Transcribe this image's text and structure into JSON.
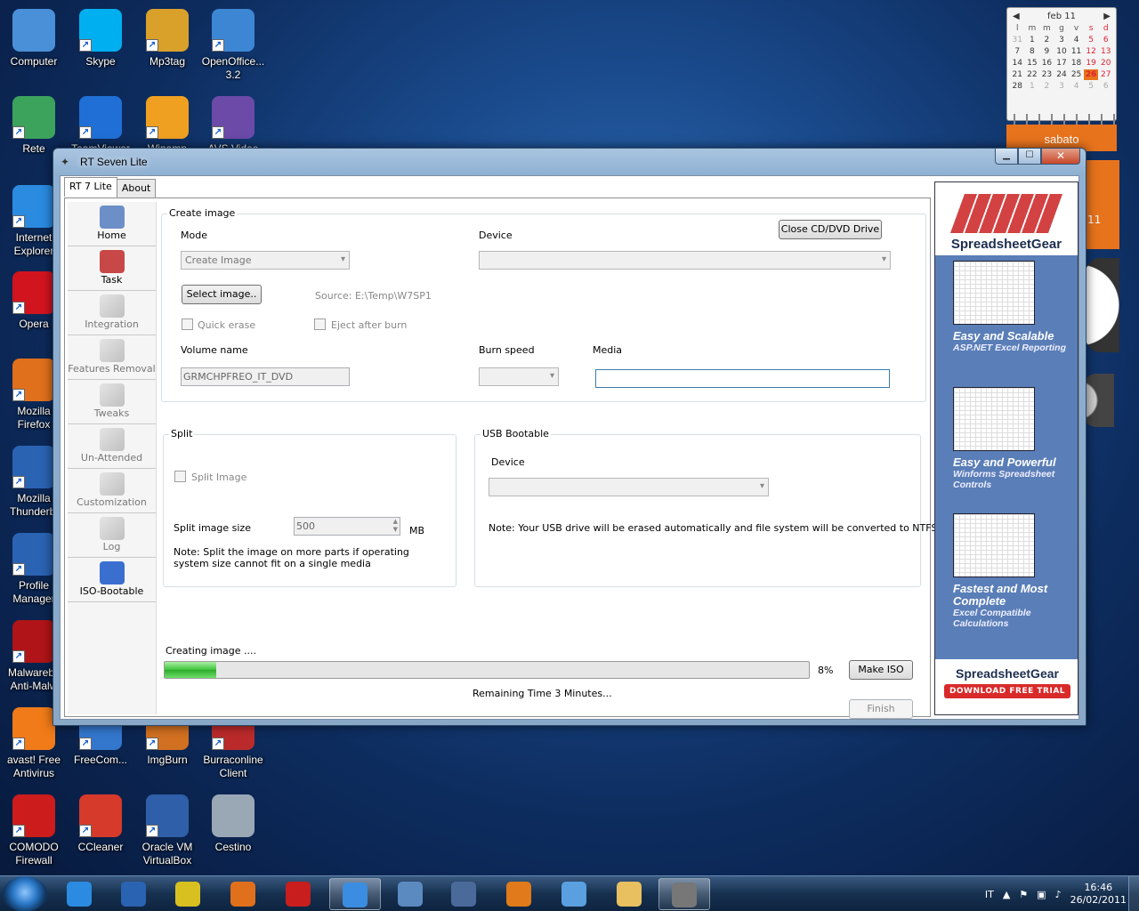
{
  "desktop": {
    "icons": [
      {
        "label": "Computer",
        "icon": "computer-icon",
        "color": "#4a90d9"
      },
      {
        "label": "Skype",
        "icon": "skype-icon",
        "color": "#00aff0"
      },
      {
        "label": "Mp3tag",
        "icon": "mp3tag-icon",
        "color": "#d9a12a"
      },
      {
        "label": "OpenOffice... 3.2",
        "icon": "openoffice-icon",
        "color": "#3d86d4"
      },
      {
        "label": "Rete",
        "icon": "network-icon",
        "color": "#3ca35c"
      },
      {
        "label": "TeamViewer",
        "icon": "teamviewer-icon",
        "color": "#1f6fd6"
      },
      {
        "label": "Winamp",
        "icon": "winamp-icon",
        "color": "#f0a020"
      },
      {
        "label": "AVS Video",
        "icon": "avs-video-icon",
        "color": "#6b4aa8"
      },
      {
        "label": "Internet Explorer",
        "icon": "internet-explorer-icon",
        "color": "#2a8be0"
      },
      {
        "label": "Opera",
        "icon": "opera-icon",
        "color": "#d2141f"
      },
      {
        "label": "Mozilla Firefox",
        "icon": "firefox-icon",
        "color": "#e0701c"
      },
      {
        "label": "Mozilla Thunderbi",
        "icon": "thunderbird-icon",
        "color": "#2b63b3"
      },
      {
        "label": "Profile Manager",
        "icon": "profile-manager-icon",
        "color": "#2b63b3"
      },
      {
        "label": "Malwareby Anti-Malw",
        "icon": "malwarebytes-icon",
        "color": "#b01418"
      },
      {
        "label": "avast! Free Antivirus",
        "icon": "avast-icon",
        "color": "#f07b18"
      },
      {
        "label": "FreeCom...",
        "icon": "freecommander-icon",
        "color": "#3377cc"
      },
      {
        "label": "ImgBurn",
        "icon": "imgburn-icon",
        "color": "#d07020"
      },
      {
        "label": "Burraconline Client",
        "icon": "burraconline-icon",
        "color": "#bb2a2a"
      },
      {
        "label": "COMODO Firewall",
        "icon": "comodo-icon",
        "color": "#cc1c1c"
      },
      {
        "label": "CCleaner",
        "icon": "ccleaner-icon",
        "color": "#d63a2a"
      },
      {
        "label": "Oracle VM VirtualBox",
        "icon": "virtualbox-icon",
        "color": "#2f5fa8"
      },
      {
        "label": "Cestino",
        "icon": "recycle-bin-icon",
        "color": "#9aa7b5"
      }
    ]
  },
  "calendar": {
    "month": "feb 11",
    "headers": [
      "l",
      "m",
      "m",
      "g",
      "v",
      "s",
      "d"
    ],
    "weeks": [
      [
        "31",
        "1",
        "2",
        "3",
        "4",
        "5",
        "6"
      ],
      [
        "7",
        "8",
        "9",
        "10",
        "11",
        "12",
        "13"
      ],
      [
        "14",
        "15",
        "16",
        "17",
        "18",
        "19",
        "20"
      ],
      [
        "21",
        "22",
        "23",
        "24",
        "25",
        "26",
        "27"
      ],
      [
        "28",
        "1",
        "2",
        "3",
        "4",
        "5",
        "6"
      ]
    ],
    "today": "26",
    "weekday": "sabato",
    "side_number": "11"
  },
  "window": {
    "title": "RT Seven Lite",
    "tabs": [
      "RT 7 Lite",
      "About"
    ],
    "nav": [
      {
        "label": "Home",
        "icon": "home-icon",
        "enabled": true
      },
      {
        "label": "Task",
        "icon": "task-icon",
        "enabled": true
      },
      {
        "label": "Integration",
        "icon": "integration-icon",
        "enabled": false
      },
      {
        "label": "Features Removal",
        "icon": "features-removal-icon",
        "enabled": false
      },
      {
        "label": "Tweaks",
        "icon": "tweaks-icon",
        "enabled": false
      },
      {
        "label": "Un-Attended",
        "icon": "unattended-icon",
        "enabled": false
      },
      {
        "label": "Customization",
        "icon": "customization-icon",
        "enabled": false
      },
      {
        "label": "Log",
        "icon": "log-icon",
        "enabled": false
      },
      {
        "label": "ISO-Bootable",
        "icon": "iso-bootable-icon",
        "enabled": true
      }
    ],
    "create_image": {
      "legend": "Create image",
      "mode_label": "Mode",
      "mode_value": "Create Image",
      "device_label": "Device",
      "device_value": "",
      "close_drive_button": "Close CD/DVD Drive",
      "select_image_button": "Select image..",
      "source_text": "Source: E:\\Temp\\W7SP1",
      "quick_erase_label": "Quick erase",
      "eject_label": "Eject after burn",
      "volume_label": "Volume name",
      "volume_value": "GRMCHPFREO_IT_DVD",
      "burn_speed_label": "Burn speed",
      "media_label": "Media",
      "media_value": ""
    },
    "split": {
      "legend": "Split",
      "split_image_label": "Split Image",
      "size_label": "Split image size",
      "size_value": "500",
      "size_unit": "MB",
      "note": "Note: Split the image on more parts if operating system size cannot fit on a single media"
    },
    "usb": {
      "legend": "USB Bootable",
      "device_label": "Device",
      "device_value": "",
      "note": "Note: Your USB drive will be erased automatically and file system will be converted to NTFS."
    },
    "progress": {
      "status": "Creating image ....",
      "percent_value": 8,
      "percent_text": "8%",
      "remaining": "Remaining Time 3 Minutes...",
      "make_iso_button": "Make ISO",
      "finish_button": "Finish"
    }
  },
  "ad": {
    "brand": "SpreadsheetGear",
    "blocks": [
      {
        "title": "Easy and Scalable",
        "sub": "ASP.NET Excel Reporting"
      },
      {
        "title": "Easy and Powerful",
        "sub": "Winforms Spreadsheet Controls"
      },
      {
        "title": "Fastest and Most Complete",
        "sub": "Excel Compatible Calculations"
      }
    ],
    "cta": "DOWNLOAD FREE TRIAL"
  },
  "taskbar": {
    "apps": [
      {
        "icon": "internet-explorer-icon",
        "color": "#2a8be0",
        "active": false
      },
      {
        "icon": "thunderbird-icon",
        "color": "#2b63b3",
        "active": false
      },
      {
        "icon": "nero-icon",
        "color": "#d8c020",
        "active": false
      },
      {
        "icon": "firefox-icon",
        "color": "#e0701c",
        "active": false
      },
      {
        "icon": "filezilla-icon",
        "color": "#c81e1e",
        "active": false
      },
      {
        "icon": "safari-icon",
        "color": "#3a8de0",
        "active": true
      },
      {
        "icon": "remote-desktop-icon",
        "color": "#5a8ac0",
        "active": false
      },
      {
        "icon": "vpn-lock-icon",
        "color": "#4a6a9a",
        "active": false
      },
      {
        "icon": "media-player-icon",
        "color": "#e07a1a",
        "active": false
      },
      {
        "icon": "notepad-icon",
        "color": "#5aa0e0",
        "active": false
      },
      {
        "icon": "explorer-folder-icon",
        "color": "#e8c060",
        "active": false
      },
      {
        "icon": "rt7lite-icon",
        "color": "#777777",
        "active": true
      }
    ],
    "language": "IT",
    "time": "16:46",
    "date": "26/02/2011"
  }
}
